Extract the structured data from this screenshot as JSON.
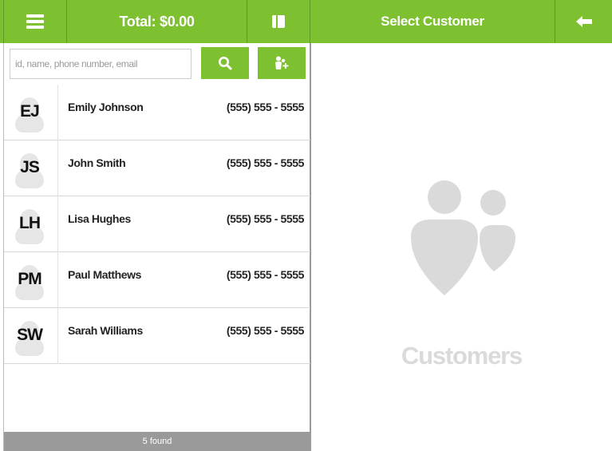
{
  "header": {
    "total_label": "Total: $0.00",
    "title": "Select Customer"
  },
  "icons": {
    "menu": "hamburger-icon",
    "drawer": "cash-drawer-icon",
    "back": "arrow-left-icon",
    "search": "magnifier-icon",
    "add_customer": "add-customer-icon",
    "customers_placeholder": "customers-icon"
  },
  "search": {
    "placeholder": "id, name, phone number, email",
    "value": ""
  },
  "customers": [
    {
      "initials": "EJ",
      "name": "Emily Johnson",
      "phone": "(555) 555 - 5555"
    },
    {
      "initials": "JS",
      "name": "John Smith",
      "phone": "(555) 555 - 5555"
    },
    {
      "initials": "LH",
      "name": "Lisa Hughes",
      "phone": "(555) 555 - 5555"
    },
    {
      "initials": "PM",
      "name": "Paul Matthews",
      "phone": "(555) 555 - 5555"
    },
    {
      "initials": "SW",
      "name": "Sarah Williams",
      "phone": "(555) 555 - 5555"
    }
  ],
  "footer": {
    "count_label": "5 found"
  },
  "empty_state": {
    "label": "Customers"
  },
  "colors": {
    "accent": "#7dc131",
    "footer": "#9a9a9a",
    "placeholder_icon": "#dadada"
  }
}
